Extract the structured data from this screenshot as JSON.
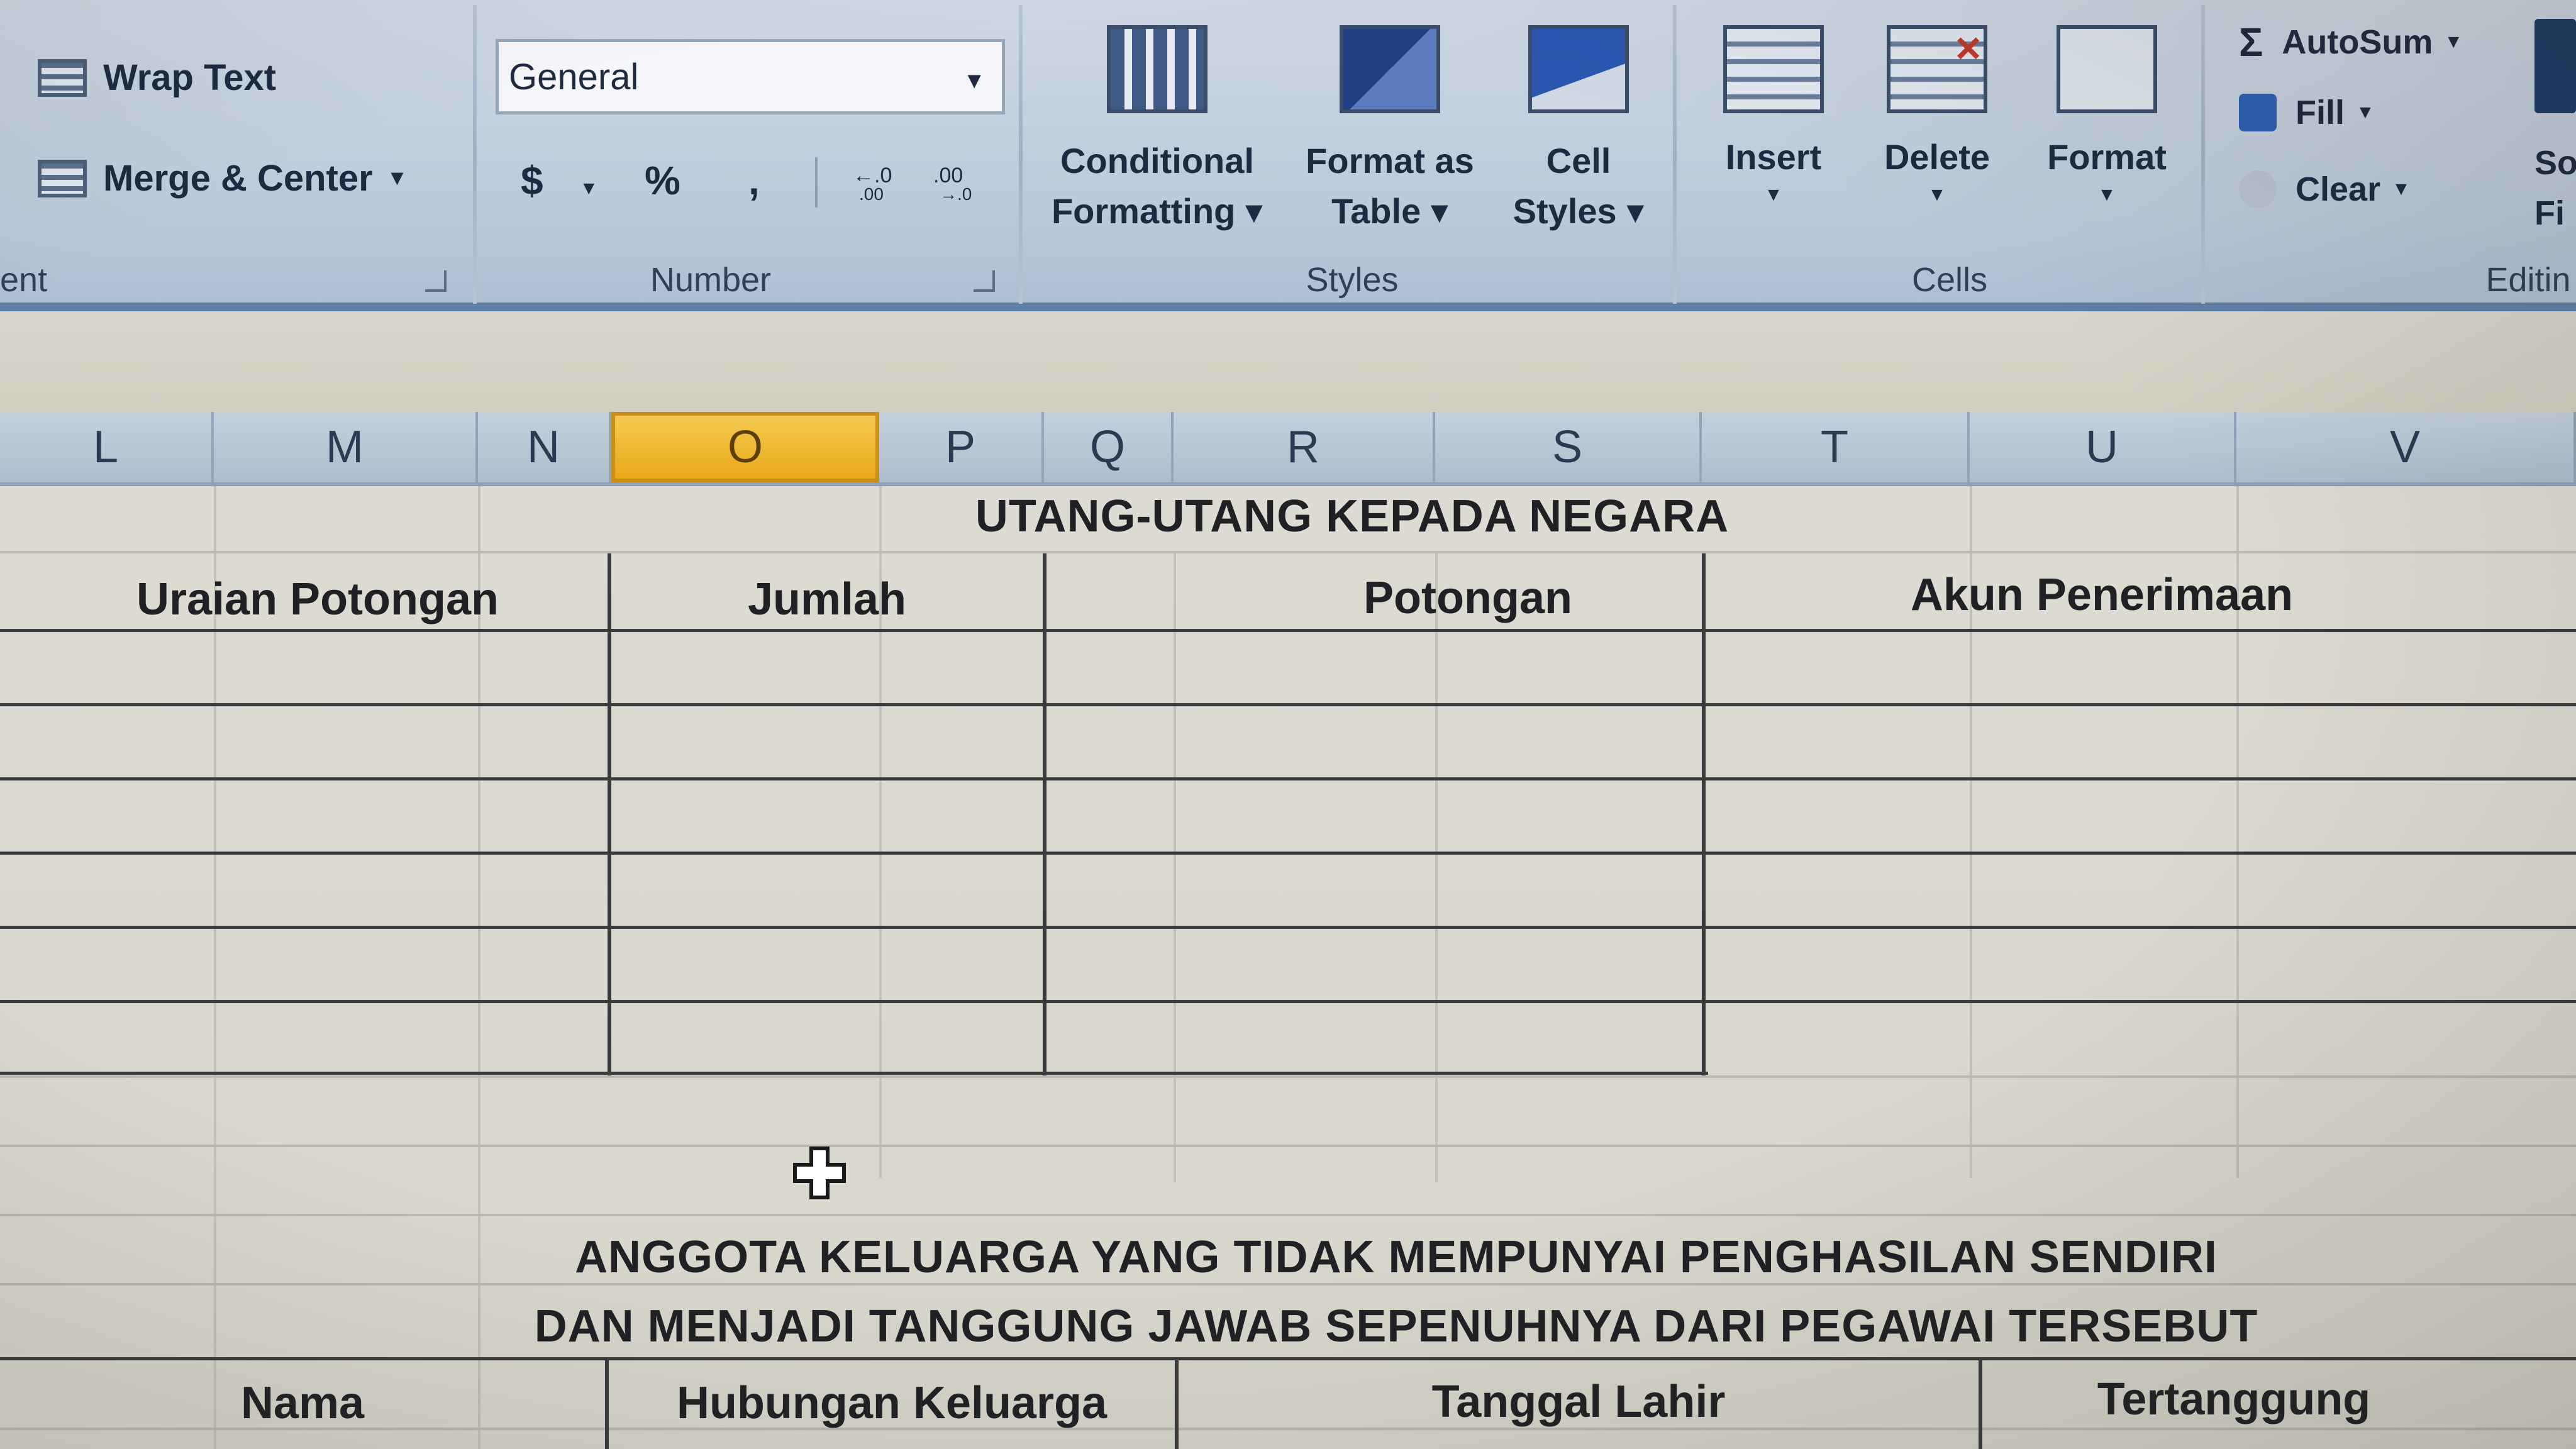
{
  "ribbon": {
    "alignment": {
      "wrap_text": "Wrap Text",
      "merge_center": "Merge & Center",
      "group_label": "ent"
    },
    "number": {
      "format_value": "General",
      "currency": "$",
      "percent": "%",
      "comma": ",",
      "group_label": "Number"
    },
    "styles": {
      "conditional_formatting": [
        "Conditional",
        "Formatting ▾"
      ],
      "format_as_table": [
        "Format as",
        "Table ▾"
      ],
      "cell_styles": [
        "Cell",
        "Styles ▾"
      ],
      "group_label": "Styles"
    },
    "cells": {
      "insert": "Insert",
      "delete": "Delete",
      "format": "Format",
      "group_label": "Cells"
    },
    "editing": {
      "autosum": "AutoSum",
      "fill": "Fill",
      "clear": "Clear",
      "sort_partial": "So",
      "filter_partial": "Fi",
      "group_label": "Editin"
    }
  },
  "columns": [
    "L",
    "M",
    "N",
    "O",
    "P",
    "Q",
    "R",
    "S",
    "T",
    "U",
    "V"
  ],
  "active_column": "O",
  "sheet": {
    "table1": {
      "title": "UTANG-UTANG KEPADA NEGARA",
      "headers": [
        "Uraian Potongan",
        "Jumlah",
        "Potongan",
        "Akun Penerimaan"
      ]
    },
    "table2": {
      "title_line1": "ANGGOTA KELUARGA YANG TIDAK MEMPUNYAI PENGHASILAN SENDIRI",
      "title_line2": "DAN MENJADI TANGGUNG JAWAB SEPENUHNYA DARI PEGAWAI TERSEBUT",
      "headers": [
        "Nama",
        "Hubungan Keluarga",
        "Tanggal Lahir",
        "Tertanggung"
      ]
    }
  },
  "colors": {
    "accent_active_column": "#e9a819",
    "ribbon_border": "#5f7ea5"
  }
}
